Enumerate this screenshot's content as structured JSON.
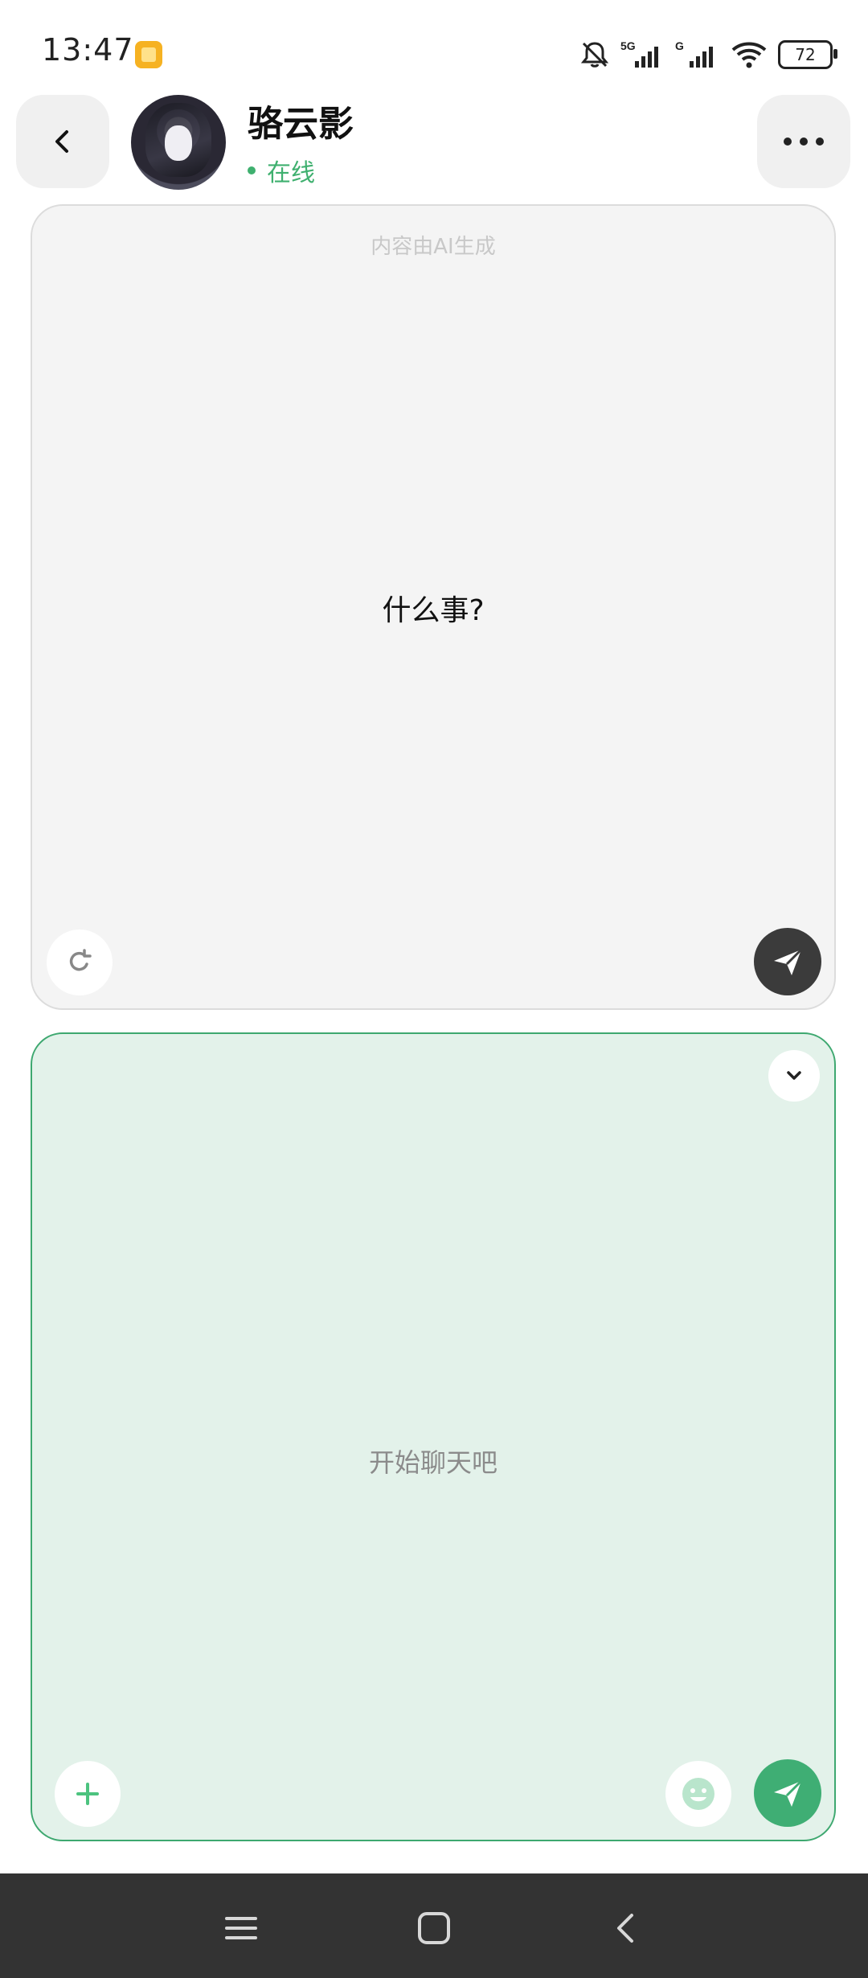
{
  "status_bar": {
    "time": "13:47",
    "network_1": "5G",
    "network_2": "G",
    "battery": "72",
    "icons": [
      "app-notification-icon",
      "bell-off-icon",
      "signal-5g-icon",
      "signal-g-icon",
      "wifi-icon",
      "battery-icon"
    ]
  },
  "header": {
    "contact_name": "骆云影",
    "status": "在线",
    "status_color": "#3fb06f",
    "back_icon": "chevron-left-icon",
    "more_icon": "more-horizontal-icon"
  },
  "ai_panel": {
    "notice": "内容由AI生成",
    "message": "什么事?",
    "refresh_icon": "refresh-icon",
    "send_icon": "send-icon"
  },
  "chat_panel": {
    "placeholder": "开始聊天吧",
    "accent_color": "#3fae74",
    "collapse_icon": "chevron-down-icon",
    "add_icon": "plus-icon",
    "emoji_icon": "emoji-icon",
    "send_icon": "send-icon"
  },
  "nav_bar": {
    "items": [
      "menu-icon",
      "home-icon",
      "back-icon"
    ]
  }
}
